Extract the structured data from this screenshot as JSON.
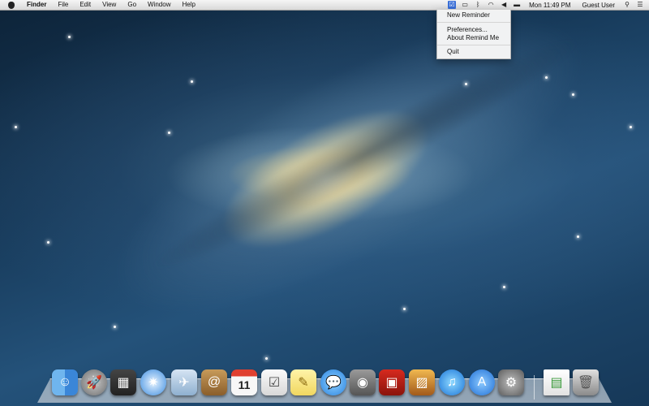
{
  "menubar": {
    "app_name": "Finder",
    "menus": [
      "File",
      "Edit",
      "View",
      "Go",
      "Window",
      "Help"
    ],
    "clock": "Mon 11:49 PM",
    "user": "Guest User"
  },
  "reminder_menu": {
    "new_reminder": "New Reminder",
    "preferences": "Preferences...",
    "about": "About Remind Me",
    "quit": "Quit"
  },
  "status_icons": [
    "remind-me-icon",
    "airplay-icon",
    "bluetooth-icon",
    "wifi-icon",
    "volume-icon",
    "battery-icon",
    "spotlight-icon",
    "notification-center-icon"
  ],
  "dock": {
    "calendar_day": "11",
    "apps": [
      "Finder",
      "Launchpad",
      "Mission Control",
      "Safari",
      "Mail",
      "Contacts",
      "Calendar",
      "Reminders",
      "Notes",
      "Messages",
      "FaceTime",
      "Photo Booth",
      "iPhoto",
      "iTunes",
      "App Store",
      "System Preferences"
    ],
    "stacks": [
      "Document",
      "Trash"
    ]
  },
  "colors": {
    "menu_highlight": "#3a6fd8",
    "wallpaper_dark": "#0d2338",
    "wallpaper_mid": "#24527a"
  }
}
